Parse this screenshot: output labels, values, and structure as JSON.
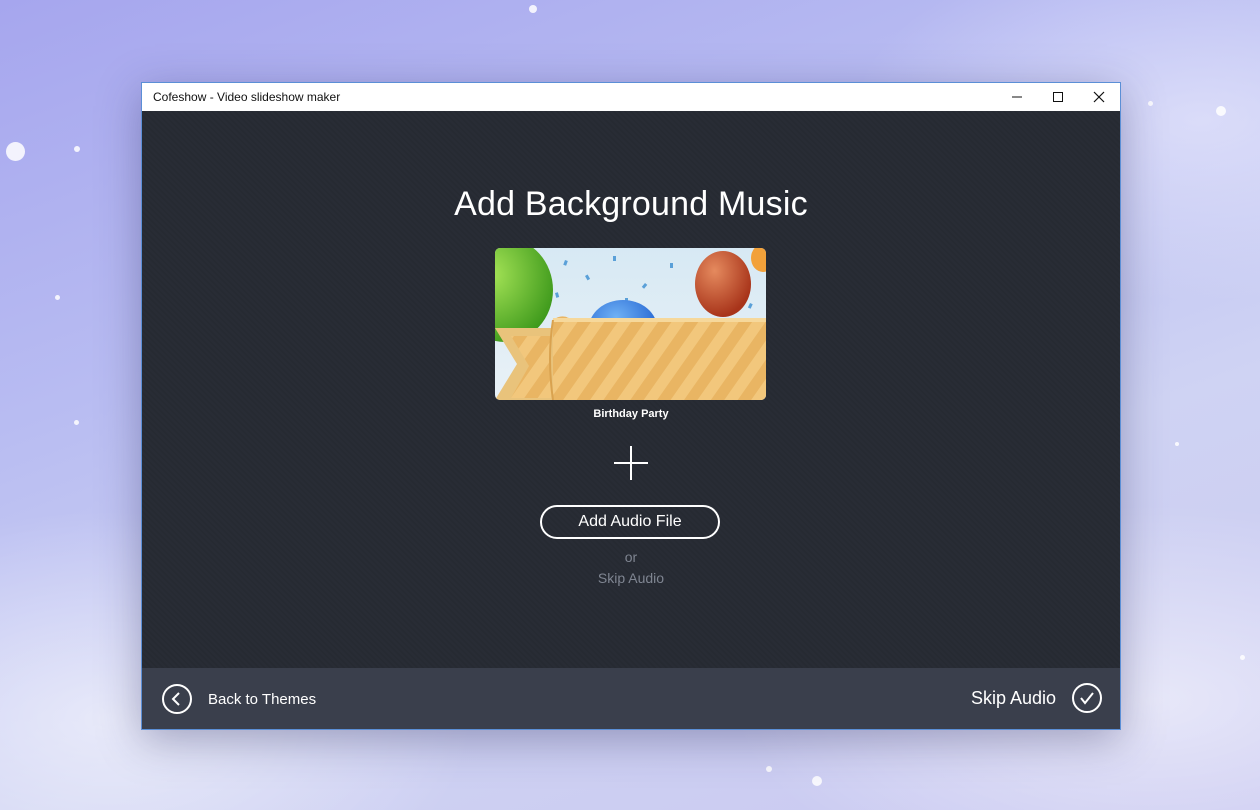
{
  "window": {
    "title": "Cofeshow - Video slideshow maker",
    "controls": {
      "minimize": "minimize-icon",
      "maximize": "maximize-icon",
      "close": "close-icon"
    }
  },
  "main": {
    "heading": "Add Background Music",
    "theme": {
      "name": "Birthday Party"
    },
    "add_audio_label": "Add Audio File",
    "or_text": "or",
    "skip_audio_link": "Skip Audio"
  },
  "footer": {
    "back_label": "Back to Themes",
    "back_icon": "chevron-left-circle-icon",
    "skip_label": "Skip Audio",
    "skip_icon": "checkmark-circle-icon"
  },
  "colors": {
    "content_bg": "#262a33",
    "footer_bg": "#3a3f4c",
    "muted_text": "#7f8591",
    "window_border": "#5b8fd6"
  }
}
